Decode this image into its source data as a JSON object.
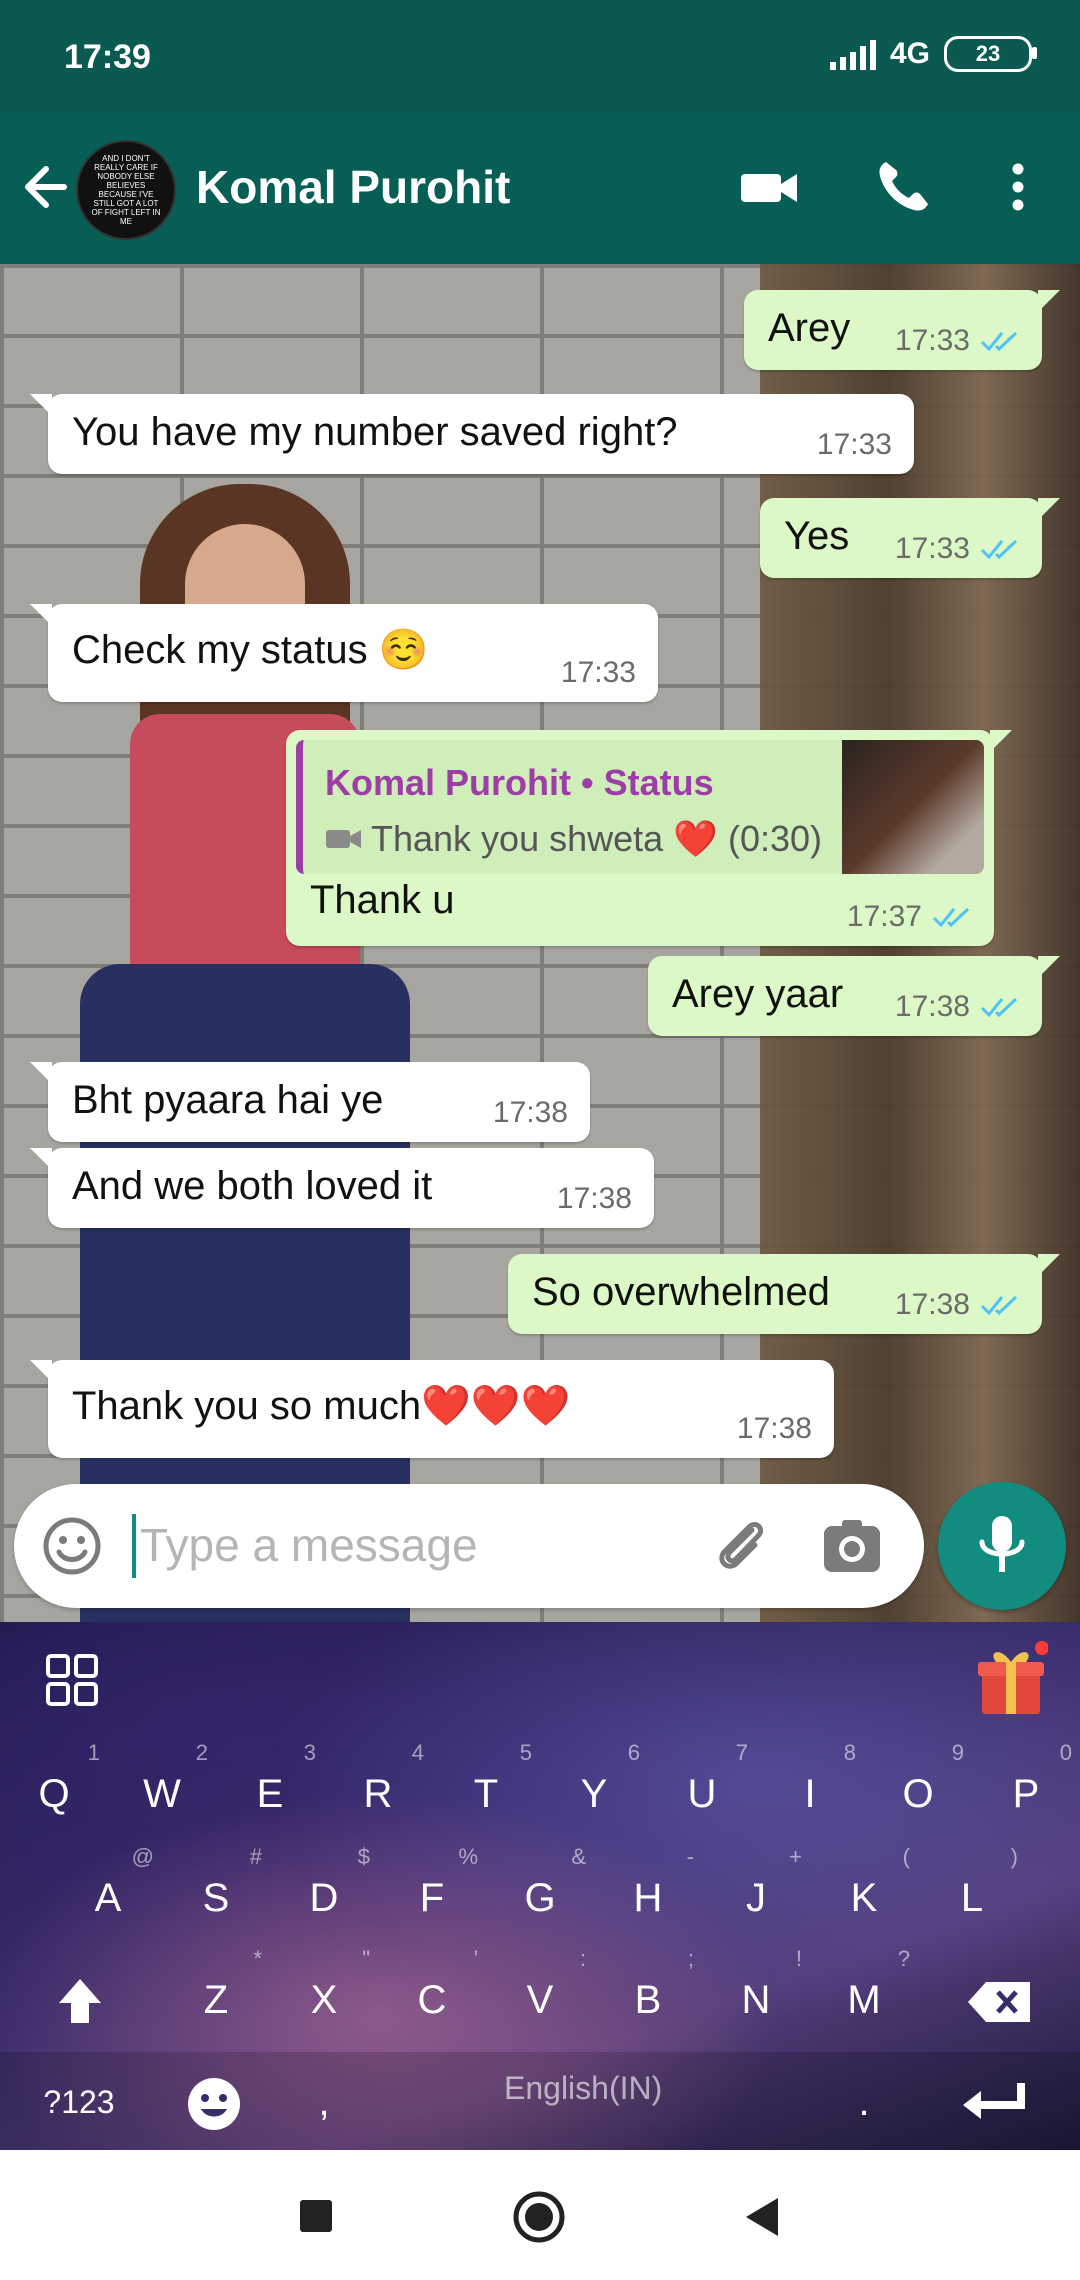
{
  "status_bar": {
    "time": "17:39",
    "network": "4G",
    "battery": "23"
  },
  "header": {
    "contact_name": "Komal Purohit",
    "avatar_text": "AND I DON'T REALLY CARE IF NOBODY ELSE BELIEVES BECAUSE I'VE STILL GOT A LOT OF FIGHT LEFT IN ME",
    "icons": [
      "back-arrow-icon",
      "video-call-icon",
      "voice-call-icon",
      "more-options-icon"
    ]
  },
  "messages": [
    {
      "dir": "out",
      "text": "Arey",
      "time": "17:33",
      "read": true
    },
    {
      "dir": "in",
      "text": "You have my number saved right?",
      "time": "17:33"
    },
    {
      "dir": "out",
      "text": "Yes",
      "time": "17:33",
      "read": true
    },
    {
      "dir": "in",
      "text": "Check my status ☺️",
      "time": "17:33"
    },
    {
      "dir": "out",
      "text": "Thank u",
      "time": "17:37",
      "read": true,
      "quote": {
        "name": "Komal Purohit • Status",
        "subtitle": "Thank you shweta ❤️ (0:30)"
      }
    },
    {
      "dir": "out",
      "text": "Arey yaar",
      "time": "17:38",
      "read": true
    },
    {
      "dir": "in",
      "text": "Bht pyaara hai ye",
      "time": "17:38"
    },
    {
      "dir": "in",
      "text": "And we both loved it",
      "time": "17:38"
    },
    {
      "dir": "out",
      "text": "So overwhelmed",
      "time": "17:38",
      "read": true
    },
    {
      "dir": "in",
      "text": "Thank you so much❤️❤️❤️",
      "time": "17:38"
    }
  ],
  "composer": {
    "placeholder": "Type a message"
  },
  "keyboard": {
    "row1": [
      "Q",
      "W",
      "E",
      "R",
      "T",
      "Y",
      "U",
      "I",
      "O",
      "P"
    ],
    "row1_hints": [
      "1",
      "2",
      "3",
      "4",
      "5",
      "6",
      "7",
      "8",
      "9",
      "0"
    ],
    "row2": [
      "A",
      "S",
      "D",
      "F",
      "G",
      "H",
      "J",
      "K",
      "L"
    ],
    "row2_hints": [
      "@",
      "#",
      "$",
      "%",
      "&",
      "-",
      "+",
      "(",
      ")"
    ],
    "row3": [
      "Z",
      "X",
      "C",
      "V",
      "B",
      "N",
      "M"
    ],
    "row3_hints": [
      "*",
      "\"",
      "'",
      ":",
      ";",
      "!",
      "?"
    ],
    "symbols_key": "?123",
    "comma_key": ",",
    "period_key": ".",
    "space_label": "English(IN)"
  },
  "colors": {
    "status_bar": "#0a5a51",
    "header": "#075e54",
    "accent": "#128c7e",
    "outgoing_bubble": "#dcf8c6",
    "incoming_bubble": "#ffffff",
    "read_ticks": "#4fc3f7",
    "quote_name": "#9c3ea5"
  }
}
